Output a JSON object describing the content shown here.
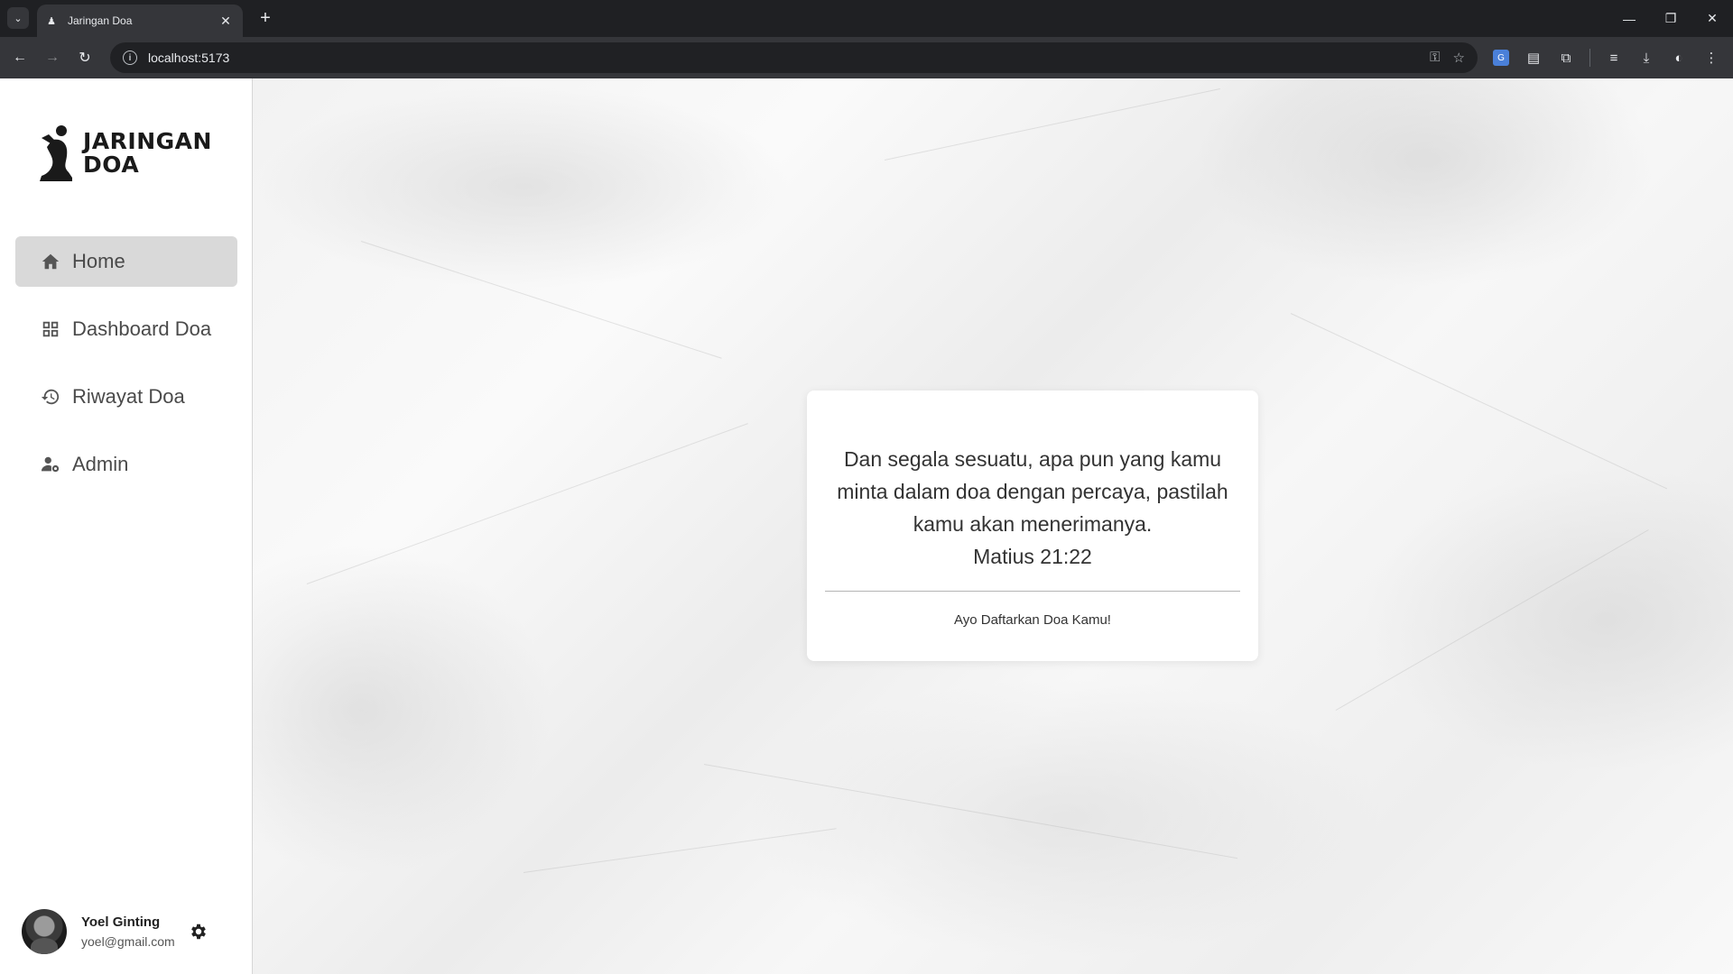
{
  "browser": {
    "tab_title": "Jaringan Doa",
    "url": "localhost:5173"
  },
  "sidebar": {
    "brand_line1": "JARINGAN",
    "brand_line2": "DOA",
    "items": [
      {
        "label": "Home",
        "icon": "home-icon",
        "active": true
      },
      {
        "label": "Dashboard Doa",
        "icon": "grid-icon",
        "active": false
      },
      {
        "label": "Riwayat Doa",
        "icon": "history-icon",
        "active": false
      },
      {
        "label": "Admin",
        "icon": "user-gear-icon",
        "active": false
      }
    ],
    "user": {
      "name": "Yoel Ginting",
      "email": "yoel@gmail.com"
    }
  },
  "card": {
    "verse": "Dan segala sesuatu, apa pun yang kamu minta dalam doa dengan percaya, pastilah kamu akan menerimanya.",
    "reference": "Matius 21:22",
    "cta": "Ayo Daftarkan Doa Kamu!"
  },
  "colors": {
    "sidebar_bg": "#ffffff",
    "active_item_bg": "#d9d9d9",
    "chrome_bg": "#35363a"
  }
}
